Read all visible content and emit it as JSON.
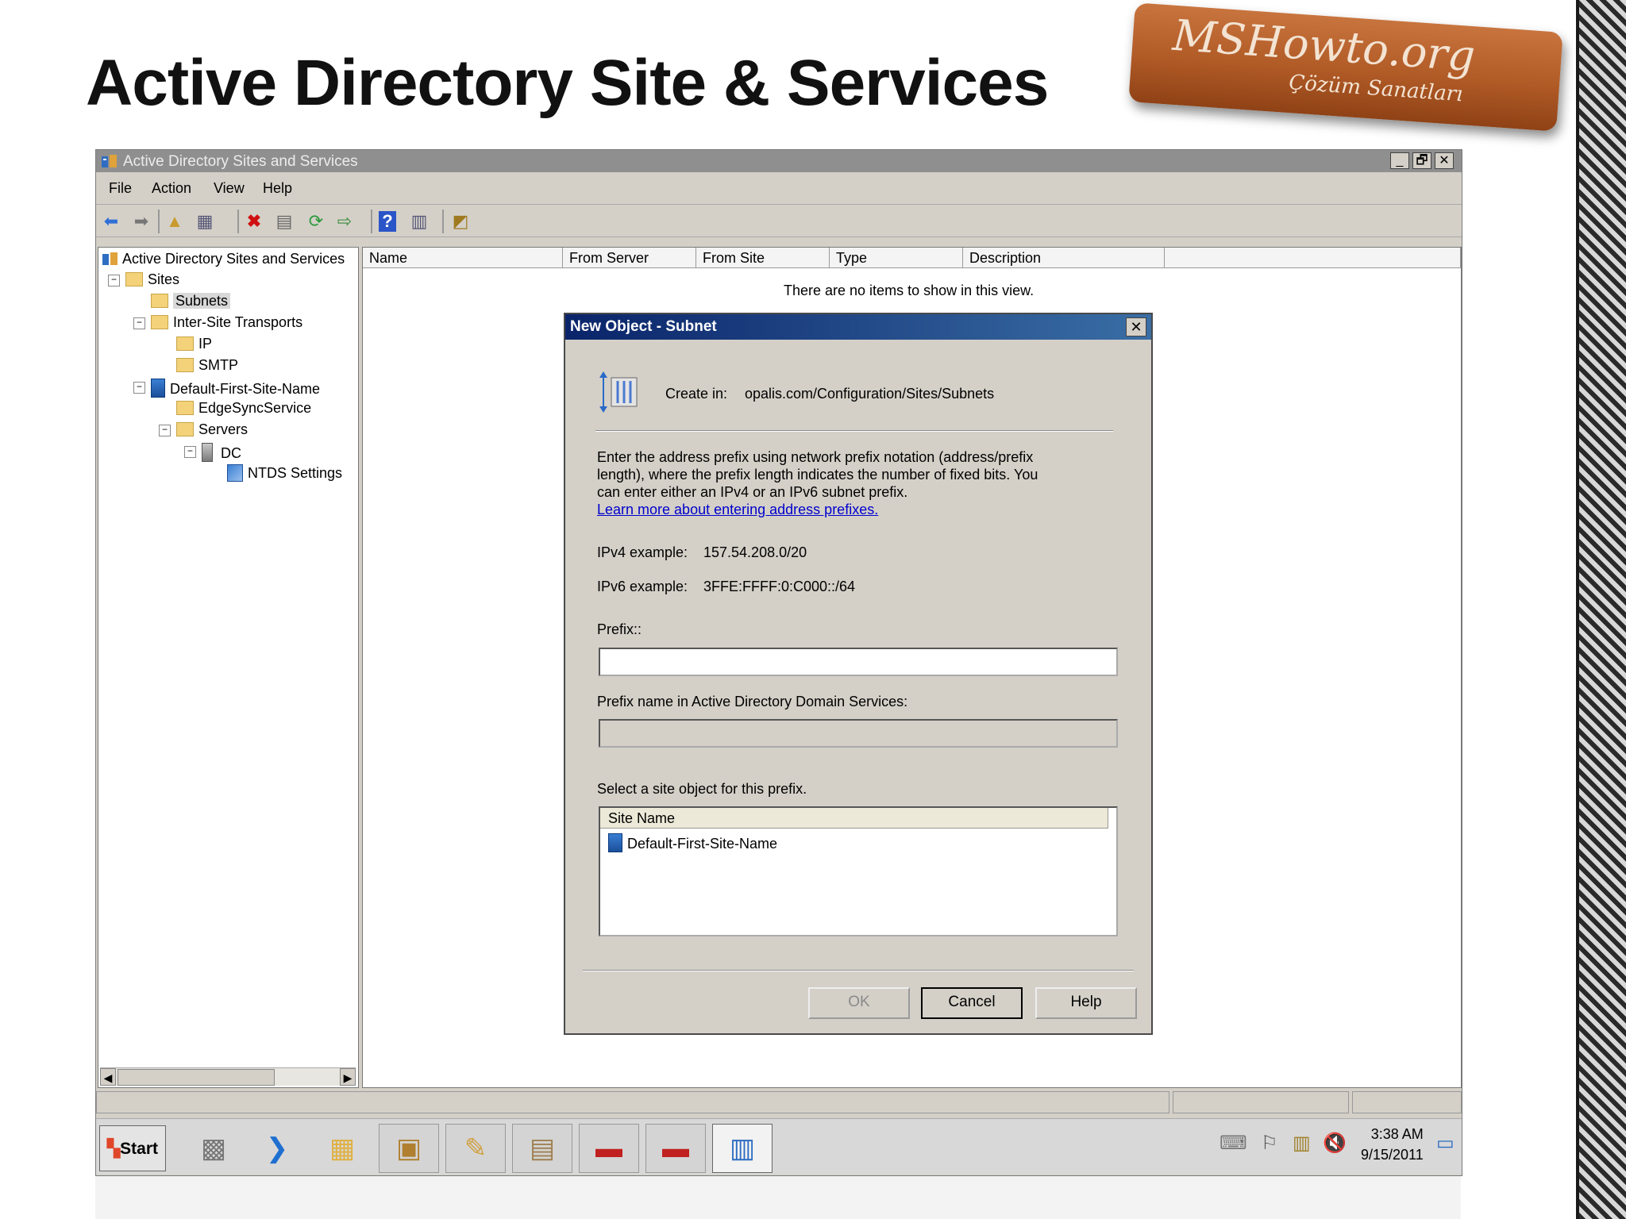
{
  "slide": {
    "title": "Active Directory Site & Services"
  },
  "logo": {
    "main": "MSHowto.org",
    "sub": "Çözüm Sanatları"
  },
  "window": {
    "title": "Active Directory Sites and Services",
    "controls": [
      "_",
      "🗗",
      "✕"
    ],
    "menu": [
      "File",
      "Action",
      "View",
      "Help"
    ],
    "toolbar_icons": [
      "back-arrow-icon",
      "forward-arrow-icon",
      "up-folder-icon",
      "show-hide-tree-icon",
      "delete-icon",
      "properties-icon",
      "refresh-icon",
      "export-list-icon",
      "help-icon",
      "columns-icon",
      "new-object-icon"
    ]
  },
  "tree": {
    "root": "Active Directory Sites and Services",
    "sites": "Sites",
    "subnets": "Subnets",
    "inter_site": "Inter-Site Transports",
    "ip": "IP",
    "smtp": "SMTP",
    "default_site": "Default-First-Site-Name",
    "edgesync": "EdgeSyncService",
    "servers": "Servers",
    "dc": "DC",
    "ntds": "NTDS Settings"
  },
  "list": {
    "columns": [
      "Name",
      "From Server",
      "From Site",
      "Type",
      "Description"
    ],
    "empty_message": "There are no items to show in this view."
  },
  "dialog": {
    "title": "New Object - Subnet",
    "close": "✕",
    "create_in_label": "Create in:",
    "create_in_path": "opalis.com/Configuration/Sites/Subnets",
    "desc_line1": "Enter the address prefix using network prefix notation (address/prefix",
    "desc_line2": "length), where the prefix length indicates the number of fixed bits. You",
    "desc_line3": "can enter either an IPv4 or an IPv6 subnet prefix.",
    "learn_more": "Learn more about entering address prefixes.",
    "ipv4_label": "IPv4 example:",
    "ipv4_value": "157.54.208.0/20",
    "ipv6_label": "IPv6 example:",
    "ipv6_value": "3FFE:FFFF:0:C000::/64",
    "prefix_label": "Prefix::",
    "prefix_value": "",
    "prefix_name_label": "Prefix name in Active Directory Domain Services:",
    "prefix_name_value": "",
    "site_select_label": "Select a site object for this prefix.",
    "site_column": "Site Name",
    "sites": [
      "Default-First-Site-Name"
    ],
    "ok": "OK",
    "cancel": "Cancel",
    "help": "Help"
  },
  "taskbar": {
    "start": "Start",
    "time": "3:38 AM",
    "date": "9/15/2011"
  }
}
